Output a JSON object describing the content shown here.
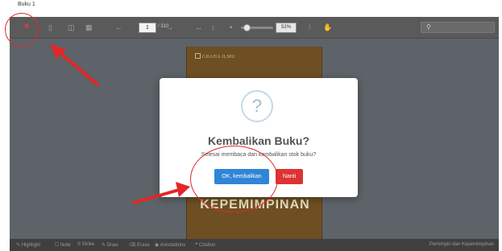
{
  "tab": {
    "title": "Buku 1"
  },
  "toolbar": {
    "close_glyph": "✕",
    "current_page": "1",
    "page_total": "/ 310",
    "zoom": "52%",
    "prev_glyph": "←",
    "next_glyph": "→"
  },
  "book": {
    "publisher": "GRAHA ILMU",
    "title": "KEPEMIMPINAN"
  },
  "modal": {
    "icon": "?",
    "title": "Kembalikan Buku?",
    "text": "Selesai membaca dan kembalikan stok buku?",
    "confirm_label": "OK, kembalikan",
    "cancel_label": "Nanti"
  },
  "bottombar": {
    "items": [
      "Highlight",
      "Note",
      "Strike",
      "Draw",
      "Erase",
      "Annotations",
      "Citation"
    ],
    "right_text": "Pemimpin dan Kepemimpinan"
  },
  "colors": {
    "toolbar_bg": "#5a5a5a",
    "confirm_button": "#3085d6",
    "cancel_button": "#dd3333",
    "annotation_red": "#e32727",
    "book_cover": "#6d4f23"
  }
}
